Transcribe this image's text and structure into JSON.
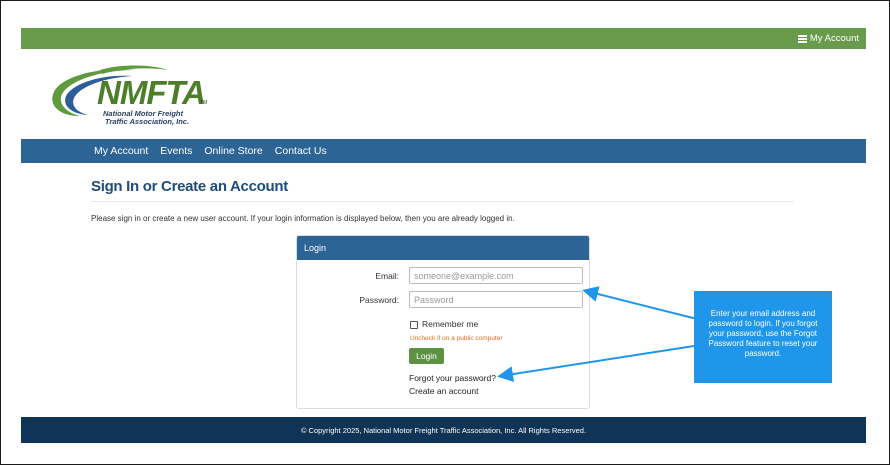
{
  "topbar": {
    "account_label": "My Account"
  },
  "logo": {
    "wordmark": "NMFTA",
    "tm": "TM",
    "subtitle_line1": "National Motor Freight",
    "subtitle_line2": "Traffic Association, Inc."
  },
  "nav": {
    "items": [
      {
        "label": "My Account"
      },
      {
        "label": "Events"
      },
      {
        "label": "Online Store"
      },
      {
        "label": "Contact Us"
      }
    ]
  },
  "page": {
    "title": "Sign In or Create an Account",
    "intro": "Please sign in or create a new user account. If your login information is displayed below, then you are already logged in."
  },
  "login": {
    "panel_title": "Login",
    "email_label": "Email:",
    "email_placeholder": "someone@example.com",
    "email_value": "",
    "password_label": "Password:",
    "password_placeholder": "Password",
    "password_value": "",
    "remember_label": "Remember me",
    "remember_checked": false,
    "remember_hint": "Uncheck if on a public computer",
    "login_button": "Login",
    "forgot_link": "Forgot your password?",
    "create_link": "Create an account"
  },
  "callout": {
    "text": "Enter your email address and password to login. If you forgot your password, use the Forgot Password feature to reset your password."
  },
  "footer": {
    "copyright": "© Copyright 2025, National Motor Freight Traffic Association, Inc. All Rights Reserved."
  },
  "colors": {
    "green_bar": "#6a9a4b",
    "nav_blue": "#2b6495",
    "footer_navy": "#0f3456",
    "title_blue": "#1f4c78",
    "callout_blue": "#1f96ea",
    "button_green": "#5d9245",
    "hint_orange": "#e06b1f"
  },
  "icons": {
    "account_icon": "list-icon",
    "logo_swoosh": "swoosh-logo"
  }
}
